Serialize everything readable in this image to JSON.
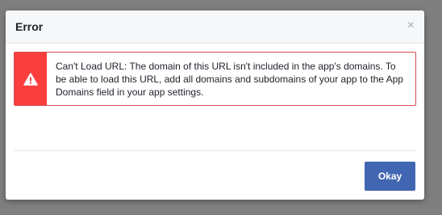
{
  "dialog": {
    "title": "Error",
    "close_icon": "close-icon",
    "close_glyph": "×"
  },
  "alert": {
    "icon": "warning-icon",
    "message": "Can't Load URL: The domain of this URL isn't included in the app's domains. To be able to load this URL, add all domains and subdomains of your app to the App Domains field in your app settings.",
    "accent_color": "#fa3e3e"
  },
  "footer": {
    "okay_label": "Okay",
    "button_color": "#4267b2"
  }
}
